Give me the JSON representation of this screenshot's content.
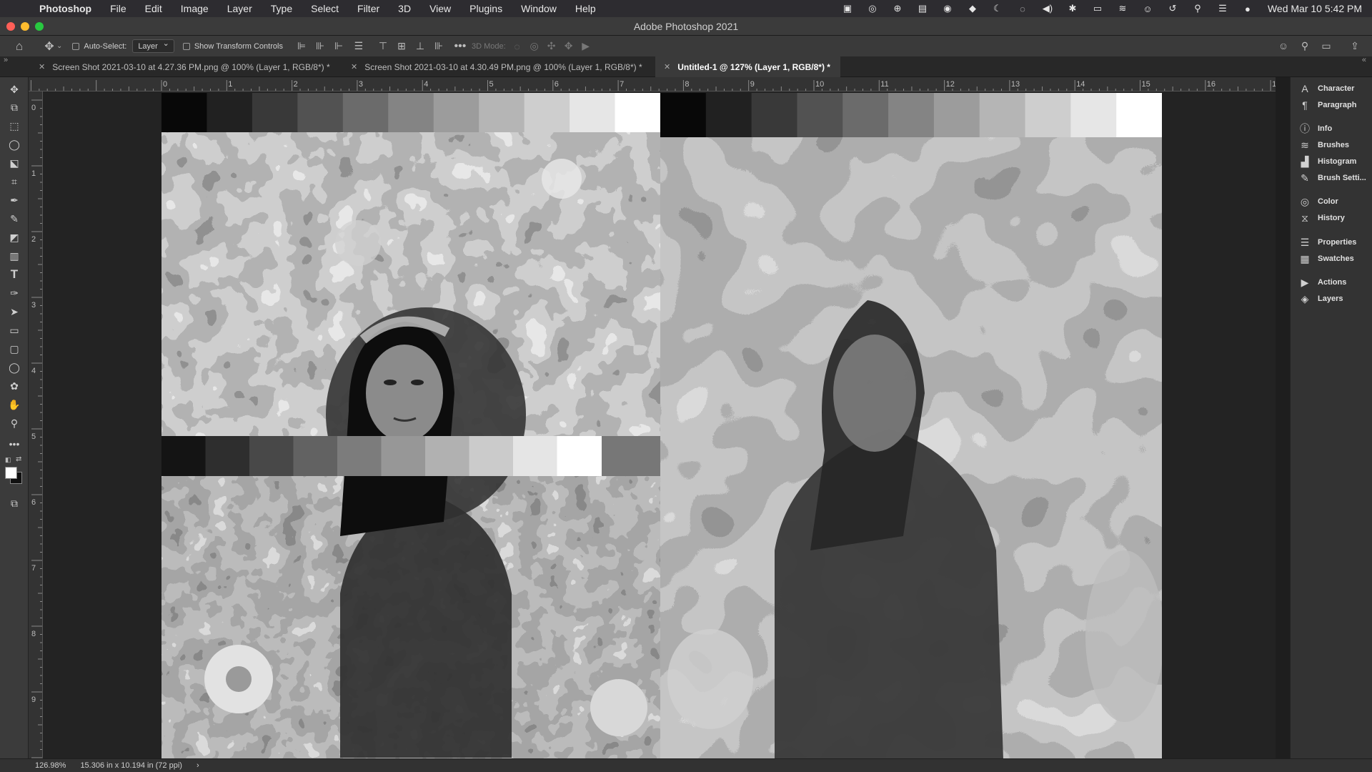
{
  "menubar": {
    "app_name": "Photoshop",
    "items": [
      "File",
      "Edit",
      "Image",
      "Layer",
      "Type",
      "Select",
      "Filter",
      "3D",
      "View",
      "Plugins",
      "Window",
      "Help"
    ],
    "clock": "Wed Mar 10  5:42 PM"
  },
  "window": {
    "title": "Adobe Photoshop 2021",
    "traffic_colors": [
      "#ff5f57",
      "#febc2e",
      "#28c840"
    ]
  },
  "options": {
    "auto_select_label": "Auto-Select:",
    "auto_select_value": "Layer",
    "transform_label": "Show Transform Controls",
    "mode_3d_label": "3D Mode:"
  },
  "tabs": [
    {
      "label": "Screen Shot 2021-03-10 at 4.27.36 PM.png @ 100% (Layer 1, RGB/8*) *"
    },
    {
      "label": "Screen Shot 2021-03-10 at 4.30.49 PM.png @ 100% (Layer 1, RGB/8*) *"
    },
    {
      "label": "Untitled-1 @ 127% (Layer 1, RGB/8*) *"
    }
  ],
  "ruler": {
    "top": [
      "0",
      "1",
      "2",
      "3",
      "4",
      "5",
      "6",
      "7",
      "8",
      "9",
      "10",
      "11",
      "12",
      "13",
      "14",
      "15",
      "16",
      "1"
    ],
    "left": [
      "0",
      "1",
      "2",
      "3",
      "4",
      "5",
      "6",
      "7",
      "8",
      "9",
      "1"
    ]
  },
  "panels": [
    {
      "label": "Character",
      "icon": "character-icon",
      "glyph": "A"
    },
    {
      "label": "Paragraph",
      "icon": "paragraph-icon",
      "glyph": "¶"
    },
    {
      "label": "Info",
      "icon": "info-icon",
      "glyph": "ⓘ"
    },
    {
      "label": "Brushes",
      "icon": "brushes-icon",
      "glyph": "≋"
    },
    {
      "label": "Histogram",
      "icon": "histogram-icon",
      "glyph": "▟"
    },
    {
      "label": "Brush Setti...",
      "icon": "brush-settings-icon",
      "glyph": "✎"
    },
    {
      "label": "Color",
      "icon": "color-icon",
      "glyph": "◎"
    },
    {
      "label": "History",
      "icon": "history-icon",
      "glyph": "⧖"
    },
    {
      "label": "Properties",
      "icon": "properties-icon",
      "glyph": "☰"
    },
    {
      "label": "Swatches",
      "icon": "swatches-icon",
      "glyph": "▦"
    },
    {
      "label": "Actions",
      "icon": "actions-icon",
      "glyph": "▶"
    },
    {
      "label": "Layers",
      "icon": "layers-icon",
      "glyph": "◈"
    }
  ],
  "status": {
    "zoom": "126.98%",
    "doc_size": "15.306 in x 10.194 in (72 ppi)",
    "arrow": "›"
  }
}
